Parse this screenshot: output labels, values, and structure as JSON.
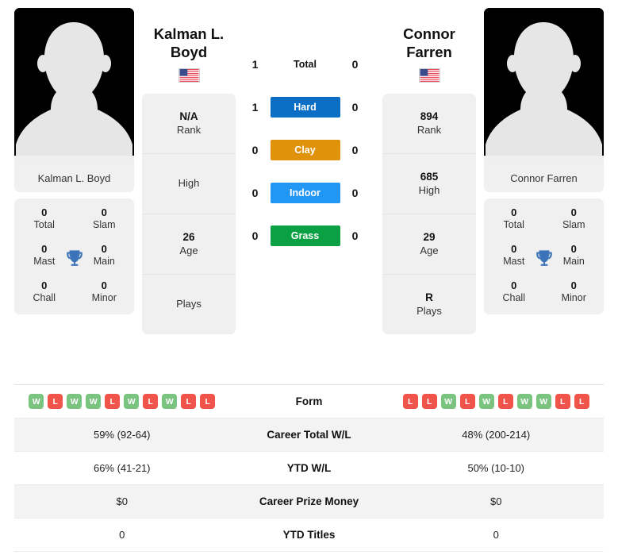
{
  "players": {
    "left": {
      "name_lines": [
        "Kalman L.",
        "Boyd"
      ],
      "full_name": "Kalman L. Boyd",
      "flag": "us-flag-icon",
      "photo": "player-silhouette-photo",
      "info": [
        {
          "value": "N/A",
          "label": "Rank"
        },
        {
          "value": "",
          "label": "High"
        },
        {
          "value": "26",
          "label": "Age"
        },
        {
          "value": "",
          "label": "Plays"
        }
      ],
      "titles": [
        {
          "value": "0",
          "label": "Total"
        },
        {
          "value": "0",
          "label": "Slam"
        },
        {
          "value": "0",
          "label": "Mast"
        },
        {
          "value": "0",
          "label": "Main"
        },
        {
          "value": "0",
          "label": "Chall"
        },
        {
          "value": "0",
          "label": "Minor"
        }
      ],
      "form": [
        "W",
        "L",
        "W",
        "W",
        "L",
        "W",
        "L",
        "W",
        "L",
        "L"
      ],
      "career_wl": "59% (92-64)",
      "ytd_wl": "66% (41-21)",
      "career_prize": "$0",
      "ytd_titles": "0"
    },
    "right": {
      "name_lines": [
        "Connor",
        "Farren"
      ],
      "full_name": "Connor Farren",
      "flag": "us-flag-icon",
      "photo": "player-silhouette-photo",
      "info": [
        {
          "value": "894",
          "label": "Rank"
        },
        {
          "value": "685",
          "label": "High"
        },
        {
          "value": "29",
          "label": "Age"
        },
        {
          "value": "R",
          "label": "Plays"
        }
      ],
      "titles": [
        {
          "value": "0",
          "label": "Total"
        },
        {
          "value": "0",
          "label": "Slam"
        },
        {
          "value": "0",
          "label": "Mast"
        },
        {
          "value": "0",
          "label": "Main"
        },
        {
          "value": "0",
          "label": "Chall"
        },
        {
          "value": "0",
          "label": "Minor"
        }
      ],
      "form": [
        "L",
        "L",
        "W",
        "L",
        "W",
        "L",
        "W",
        "W",
        "L",
        "L"
      ],
      "career_wl": "48% (200-214)",
      "ytd_wl": "50% (10-10)",
      "career_prize": "$0",
      "ytd_titles": "0"
    }
  },
  "head_to_head": [
    {
      "label": "Total",
      "left": "1",
      "right": "0",
      "style": "plain",
      "color": ""
    },
    {
      "label": "Hard",
      "left": "1",
      "right": "0",
      "style": "surface",
      "color": "#0a6ec4"
    },
    {
      "label": "Clay",
      "left": "0",
      "right": "0",
      "style": "surface",
      "color": "#e0930a"
    },
    {
      "label": "Indoor",
      "left": "0",
      "right": "0",
      "style": "surface",
      "color": "#2196f3"
    },
    {
      "label": "Grass",
      "left": "0",
      "right": "0",
      "style": "surface",
      "color": "#0ba044"
    }
  ],
  "stats_rows": [
    {
      "key": "form",
      "label": "Form",
      "type": "form"
    },
    {
      "key": "career_wl",
      "label": "Career Total W/L",
      "type": "text"
    },
    {
      "key": "ytd_wl",
      "label": "YTD W/L",
      "type": "text"
    },
    {
      "key": "career_prize",
      "label": "Career Prize Money",
      "type": "text"
    },
    {
      "key": "ytd_titles",
      "label": "YTD Titles",
      "type": "text"
    }
  ],
  "colors": {
    "win": "#7ac47f",
    "loss": "#f0544a",
    "card_bg": "#f0f0f0",
    "row_alt": "#f3f3f3",
    "trophy": "#3b74b9"
  }
}
